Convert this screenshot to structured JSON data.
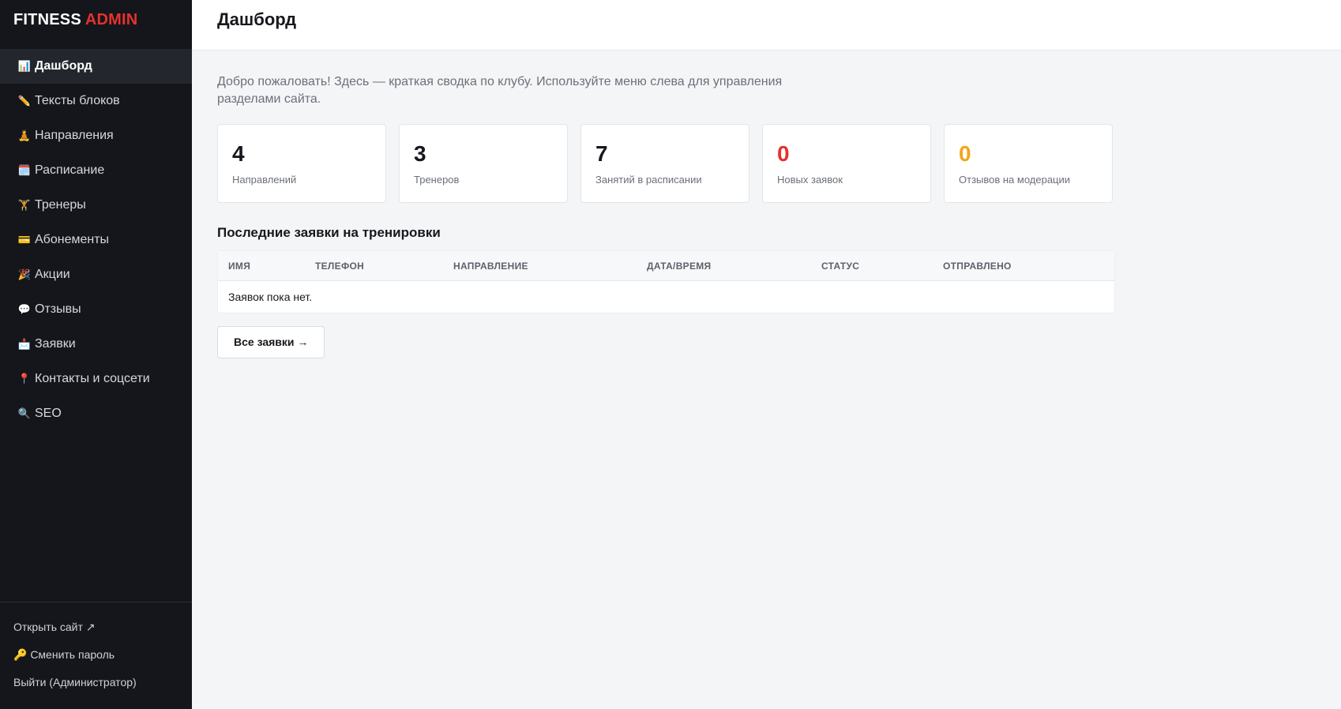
{
  "brand": {
    "name": "FITNESS",
    "accent": "ADMIN",
    "accent_color": "#e5322d"
  },
  "sidebar": {
    "items": [
      {
        "icon": "📊",
        "label": "Дашборд",
        "active": true
      },
      {
        "icon": "✏️",
        "label": "Тексты блоков"
      },
      {
        "icon": "🧘",
        "label": "Направления"
      },
      {
        "icon": "🗓️",
        "label": "Расписание"
      },
      {
        "icon": "🏋️",
        "label": "Тренеры"
      },
      {
        "icon": "💳",
        "label": "Абонементы"
      },
      {
        "icon": "🎉",
        "label": "Акции"
      },
      {
        "icon": "💬",
        "label": "Отзывы"
      },
      {
        "icon": "📩",
        "label": "Заявки"
      },
      {
        "icon": "📍",
        "label": "Контакты и соцсети"
      },
      {
        "icon": "🔍",
        "label": "SEO"
      }
    ],
    "footer": {
      "open_site": "Открыть сайт ↗",
      "change_password": "🔑 Сменить пароль",
      "logout": "Выйти (Администратор)"
    }
  },
  "header": {
    "title": "Дашборд"
  },
  "intro": "Добро пожаловать! Здесь — краткая сводка по клубу. Используйте меню слева для управления разделами сайта.",
  "stats": [
    {
      "value": "4",
      "label": "Направлений",
      "color": "#16181d"
    },
    {
      "value": "3",
      "label": "Тренеров",
      "color": "#16181d"
    },
    {
      "value": "7",
      "label": "Занятий в расписании",
      "color": "#16181d"
    },
    {
      "value": "0",
      "label": "Новых заявок",
      "color": "#e5322d"
    },
    {
      "value": "0",
      "label": "Отзывов на модерации",
      "color": "#f2a516"
    }
  ],
  "requests": {
    "title": "Последние заявки на тренировки",
    "columns": [
      "ИМЯ",
      "ТЕЛЕФОН",
      "НАПРАВЛЕНИЕ",
      "ДАТА/ВРЕМЯ",
      "СТАТУС",
      "ОТПРАВЛЕНО"
    ],
    "empty": "Заявок пока нет.",
    "all_button": "Все заявки →"
  }
}
